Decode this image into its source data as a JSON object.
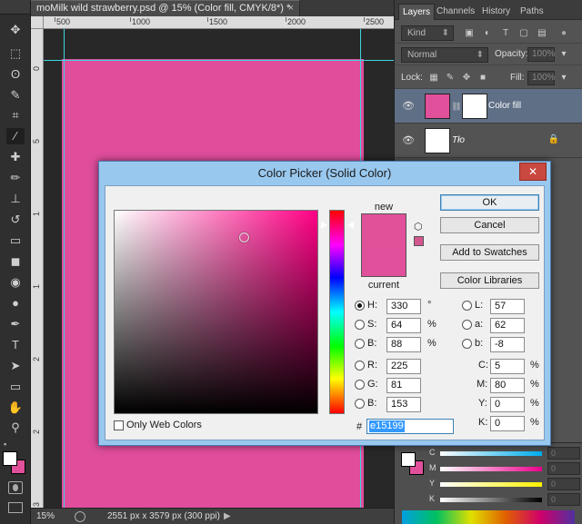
{
  "document": {
    "tab_title": "moMilk wild strawberry.psd @ 15% (Color fill, CMYK/8*) *",
    "tab_close": "×",
    "ruler_top_labels": [
      "500",
      "1000",
      "1500",
      "2000",
      "2500"
    ],
    "ruler_left_labels": [
      "0",
      "5",
      "1",
      "1",
      "2",
      "2",
      "3"
    ],
    "zoom": "15%",
    "doc_size": "2551 px x 3579 px (300 ppi)",
    "status_arrow": "▶"
  },
  "toolbar": {
    "tools": [
      "move-tool",
      "marquee-tool",
      "lasso-tool",
      "quick-select-tool",
      "crop-tool",
      "eyedropper-tool",
      "healing-tool",
      "brush-tool",
      "stamp-tool",
      "history-brush-tool",
      "eraser-tool",
      "gradient-tool",
      "blur-tool",
      "dodge-tool",
      "pen-tool",
      "type-tool",
      "path-select-tool",
      "shape-tool",
      "hand-tool",
      "zoom-tool"
    ],
    "glyphs": [
      "✥",
      "⬚",
      "ʘ",
      "✎",
      "⌗",
      "⁄",
      "✚",
      "✏",
      "⊥",
      "↺",
      "▭",
      "◼",
      "◉",
      "●",
      "✒",
      "T",
      "➤",
      "▭",
      "✋",
      "⚲"
    ],
    "fg_color": "#ffffff",
    "bg_color": "#e0509b"
  },
  "panels": {
    "tabs": [
      "Layers",
      "Channels",
      "History",
      "Paths"
    ],
    "active_tab": "Layers",
    "filter_kind": "Kind",
    "blend_mode": "Normal",
    "opacity_label": "Opacity:",
    "opacity_value": "100%",
    "lock_label": "Lock:",
    "fill_label": "Fill:",
    "fill_value": "100%",
    "layers": [
      {
        "name": "Color fill",
        "selected": true,
        "thumb_color": "#e0509b"
      },
      {
        "name": "Tło",
        "selected": false,
        "thumb_color": "#ffffff"
      }
    ],
    "lock_icon": "🔒",
    "color_panel": {
      "sliders": [
        {
          "label": "C",
          "value": "0",
          "unit": "%"
        },
        {
          "label": "M",
          "value": "0",
          "unit": "%"
        },
        {
          "label": "Y",
          "value": "0",
          "unit": "%"
        },
        {
          "label": "K",
          "value": "0",
          "unit": "%"
        }
      ]
    }
  },
  "dialog": {
    "title": "Color Picker (Solid Color)",
    "close_glyph": "✕",
    "buttons": {
      "ok": "OK",
      "cancel": "Cancel",
      "add_to_swatches": "Add to Swatches",
      "color_libraries": "Color Libraries"
    },
    "new_label": "new",
    "current_label": "current",
    "new_color": "#e15199",
    "current_color": "#e0509b",
    "hsb": [
      {
        "label": "H:",
        "value": "330",
        "unit": "°",
        "checked": true
      },
      {
        "label": "S:",
        "value": "64",
        "unit": "%",
        "checked": false
      },
      {
        "label": "B:",
        "value": "88",
        "unit": "%",
        "checked": false
      }
    ],
    "rgb": [
      {
        "label": "R:",
        "value": "225",
        "unit": ""
      },
      {
        "label": "G:",
        "value": "81",
        "unit": ""
      },
      {
        "label": "B:",
        "value": "153",
        "unit": ""
      }
    ],
    "lab": [
      {
        "label": "L:",
        "value": "57"
      },
      {
        "label": "a:",
        "value": "62"
      },
      {
        "label": "b:",
        "value": "-8"
      }
    ],
    "cmyk": [
      {
        "label": "C:",
        "value": "5",
        "unit": "%"
      },
      {
        "label": "M:",
        "value": "80",
        "unit": "%"
      },
      {
        "label": "Y:",
        "value": "0",
        "unit": "%"
      },
      {
        "label": "K:",
        "value": "0",
        "unit": "%"
      }
    ],
    "hex_hash": "#",
    "hex_value": "e15199",
    "only_web_colors": "Only Web Colors"
  }
}
